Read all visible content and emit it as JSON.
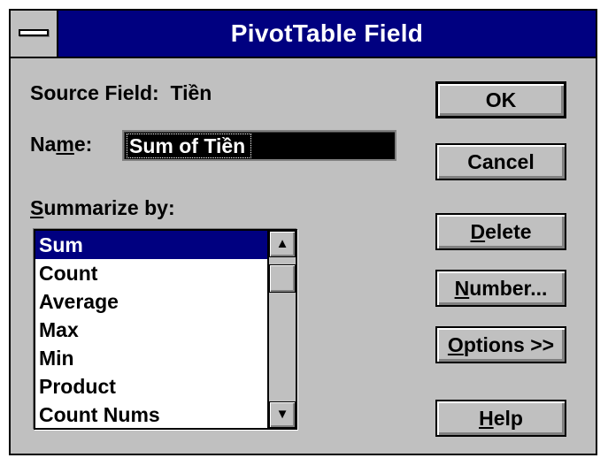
{
  "window": {
    "title": "PivotTable Field"
  },
  "source_field": {
    "label": "Source Field:",
    "value": "Tiền"
  },
  "name": {
    "label_pre": "Na",
    "label_key": "m",
    "label_post": "e:",
    "value": "Sum of Tiền"
  },
  "summarize": {
    "label_key": "S",
    "label_rest": "ummarize by:",
    "items": [
      "Sum",
      "Count",
      "Average",
      "Max",
      "Min",
      "Product",
      "Count Nums"
    ],
    "selected": "Sum"
  },
  "buttons": {
    "ok": "OK",
    "cancel": "Cancel",
    "delete_key": "D",
    "delete_rest": "elete",
    "number_key": "N",
    "number_rest": "umber...",
    "options_key": "O",
    "options_rest": "ptions >>",
    "help_key": "H",
    "help_rest": "elp"
  },
  "icons": {
    "system_menu": "system-menu-icon",
    "scroll_up": "up-arrow-icon",
    "scroll_down": "down-arrow-icon"
  },
  "colors": {
    "titlebar": "#000080",
    "face": "#c0c0c0",
    "selection": "#000080"
  }
}
